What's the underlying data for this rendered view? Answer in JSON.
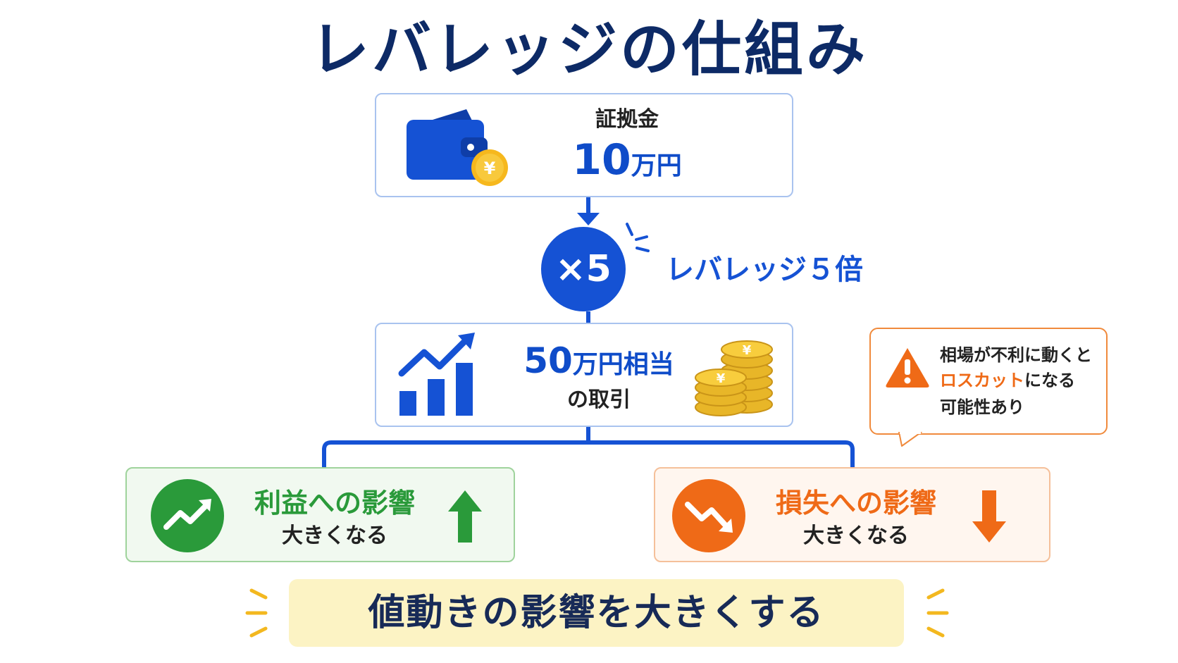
{
  "title": "レバレッジの仕組み",
  "margin": {
    "label": "証拠金",
    "amount": "10",
    "unit": "万円"
  },
  "multiplier": {
    "badge": "×5",
    "label": "レバレッジ５倍"
  },
  "position": {
    "amount": "50",
    "line1_rest": "万円相当",
    "line2": "の取引"
  },
  "warning": {
    "line1": "相場が不利に動くと",
    "line2_highlight": "ロスカット",
    "line2_rest": "になる",
    "line3": "可能性あり"
  },
  "profit": {
    "title": "利益への影響",
    "subtitle": "大きくなる"
  },
  "loss": {
    "title": "損失への影響",
    "subtitle": "大きくなる"
  },
  "summary": "値動きの影響を大きくする",
  "icons": {
    "margin": "wallet-yen-icon",
    "position_left": "bar-chart-trend-up-icon",
    "position_right": "yen-coins-icon",
    "warning": "warning-triangle-icon",
    "profit": "trend-up-circle-icon",
    "profit_arrow": "arrow-up-icon",
    "loss": "trend-down-circle-icon",
    "loss_arrow": "arrow-down-icon"
  },
  "colors": {
    "title": "#0d2a66",
    "primary_blue": "#1552d4",
    "profit_green": "#2a9a3a",
    "loss_orange": "#ef6a17",
    "banner_yellow": "#fcf3c4"
  }
}
